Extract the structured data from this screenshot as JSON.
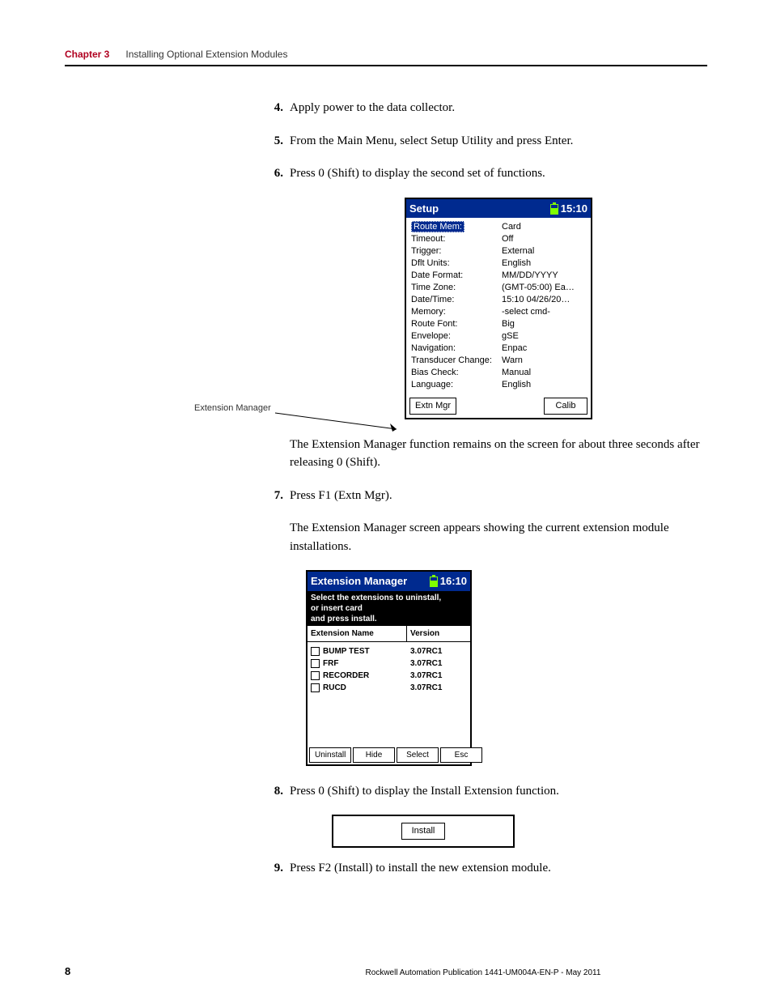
{
  "header": {
    "chapter": "Chapter 3",
    "title": "Installing Optional Extension Modules"
  },
  "steps": {
    "s4": {
      "num": "4.",
      "text": "Apply power to the data collector."
    },
    "s5": {
      "num": "5.",
      "text": "From the Main Menu, select Setup Utility and press Enter."
    },
    "s6": {
      "num": "6.",
      "text": "Press 0 (Shift) to display the second set of functions."
    },
    "s7": {
      "num": "7.",
      "text": "Press F1 (Extn Mgr)."
    },
    "s8": {
      "num": "8.",
      "text": "Press 0 (Shift) to display the Install Extension function."
    },
    "s9": {
      "num": "9.",
      "text": "Press F2 (Install) to install the new extension module."
    }
  },
  "paragraphs": {
    "p1": "The Extension Manager function remains on the screen for about three seconds after releasing 0 (Shift).",
    "p2": "The Extension Manager screen appears showing the current extension module installations."
  },
  "callout": "Extension Manager",
  "setup_screen": {
    "title": "Setup",
    "time": "15:10",
    "rows": [
      {
        "label": "Route Mem:",
        "value": "Card"
      },
      {
        "label": "Timeout:",
        "value": "Off"
      },
      {
        "label": "Trigger:",
        "value": "External"
      },
      {
        "label": "Dflt Units:",
        "value": "English"
      },
      {
        "label": "Date Format:",
        "value": "MM/DD/YYYY"
      },
      {
        "label": "Time Zone:",
        "value": "(GMT-05:00) Ea…"
      },
      {
        "label": "Date/Time:",
        "value": "15:10 04/26/20…"
      },
      {
        "label": "Memory:",
        "value": "-select cmd-"
      },
      {
        "label": "Route Font:",
        "value": "Big"
      },
      {
        "label": "Envelope:",
        "value": "gSE"
      },
      {
        "label": "Navigation:",
        "value": "Enpac"
      },
      {
        "label": "Transducer Change:",
        "value": "Warn"
      },
      {
        "label": "Bias Check:",
        "value": "Manual"
      },
      {
        "label": "Language:",
        "value": "English"
      }
    ],
    "btn_left": "Extn Mgr",
    "btn_right": "Calib"
  },
  "ext_screen": {
    "title": "Extension Manager",
    "time": "16:10",
    "instr1": "Select the extensions to uninstall,",
    "instr2": "or insert card",
    "instr3": "and press install.",
    "col_name": "Extension Name",
    "col_ver": "Version",
    "rows": [
      {
        "name": "BUMP TEST",
        "ver": "3.07RC1"
      },
      {
        "name": "FRF",
        "ver": "3.07RC1"
      },
      {
        "name": "RECORDER",
        "ver": "3.07RC1"
      },
      {
        "name": "RUCD",
        "ver": "3.07RC1"
      }
    ],
    "btn1": "Uninstall",
    "btn2": "Hide",
    "btn3": "Select",
    "btn4": "Esc"
  },
  "install_screen": {
    "btn": "Install"
  },
  "footer": {
    "page": "8",
    "pub": "Rockwell Automation Publication 1441-UM004A-EN-P - May 2011"
  }
}
